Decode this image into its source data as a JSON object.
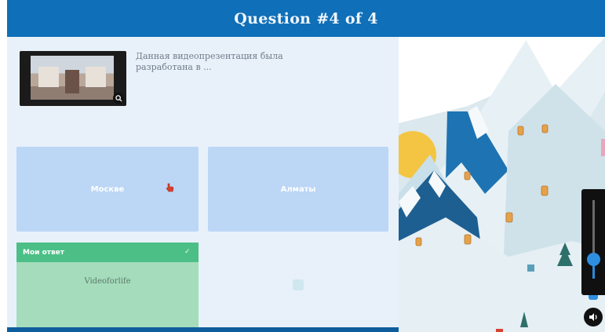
{
  "header": {
    "title": "Question #4 of 4"
  },
  "question": {
    "text": "Данная видеопрезентация была разработана в ...",
    "thumbnail": {
      "zoom_icon": "zoom-icon"
    }
  },
  "answers": [
    {
      "label": "Москве",
      "state": "default",
      "color": "#bcd6f6"
    },
    {
      "label": "Алматы",
      "state": "default",
      "color": "#bcd6f6"
    },
    {
      "label": "Videoforlife",
      "badge": "Мои ответ",
      "check": "✓",
      "state": "correct",
      "color": "#a5dcbc"
    },
    {
      "label": "",
      "state": "blank"
    }
  ],
  "volume": {
    "level": 0.25,
    "icon": "speaker-icon"
  },
  "colors": {
    "header": "#0f6fb8",
    "panel": "#e8f1fa",
    "answer": "#bcd6f6",
    "correct_bar": "#4cbf86",
    "correct_body": "#a5dcbc",
    "accent": "#2e8fe0"
  }
}
